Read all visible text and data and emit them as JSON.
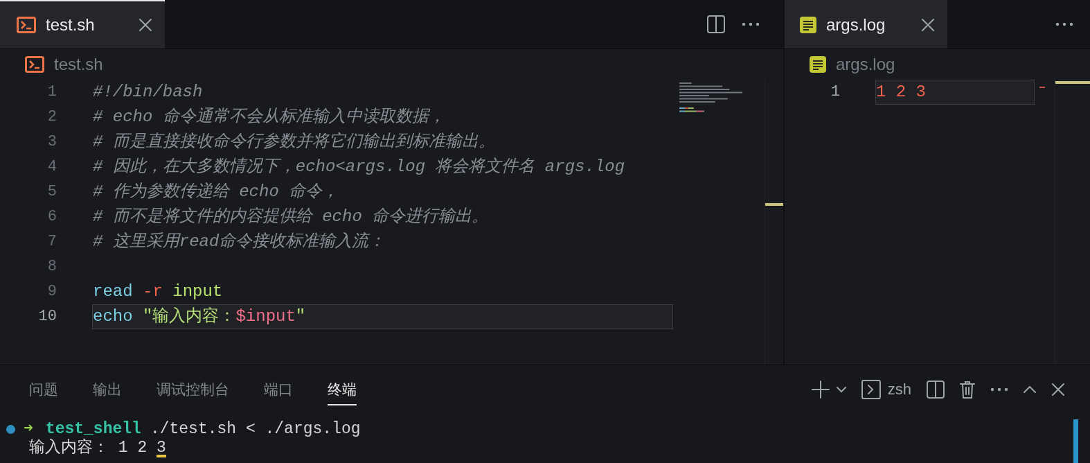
{
  "editor_groups": [
    {
      "tabs": [
        {
          "label": "test.sh",
          "kind": "shell",
          "selected": true
        }
      ],
      "actions": [
        {
          "kind": "split"
        },
        {
          "kind": "more"
        }
      ],
      "breadcrumb": {
        "label": "test.sh",
        "kind": "shell"
      },
      "lines": [
        {
          "number": "1",
          "current": false,
          "tokens": [
            {
              "kind": "comment",
              "text": "#!/bin/bash"
            }
          ]
        },
        {
          "number": "2",
          "current": false,
          "tokens": [
            {
              "kind": "comment",
              "text": "# echo 命令通常不会从标准输入中读取数据，"
            }
          ]
        },
        {
          "number": "3",
          "current": false,
          "tokens": [
            {
              "kind": "comment",
              "text": "# 而是直接接收命令行参数并将它们输出到标准输出。"
            }
          ]
        },
        {
          "number": "4",
          "current": false,
          "tokens": [
            {
              "kind": "comment",
              "text": "# 因此，在大多数情况下，echo<args.log 将会将文件名 args.log"
            }
          ]
        },
        {
          "number": "5",
          "current": false,
          "tokens": [
            {
              "kind": "comment",
              "text": "# 作为参数传递给 echo 命令，"
            }
          ]
        },
        {
          "number": "6",
          "current": false,
          "tokens": [
            {
              "kind": "comment",
              "text": "# 而不是将文件的内容提供给 echo 命令进行输出。"
            }
          ]
        },
        {
          "number": "7",
          "current": false,
          "tokens": [
            {
              "kind": "comment",
              "text": "# 这里采用read命令接收标准输入流："
            }
          ]
        },
        {
          "number": "8",
          "current": false
        },
        {
          "number": "9",
          "current": false,
          "tokens": [
            {
              "kind": "keyword",
              "text": "read "
            },
            {
              "kind": "flag",
              "text": "-r "
            },
            {
              "kind": "name",
              "text": "input"
            }
          ]
        },
        {
          "number": "10",
          "current": true,
          "tokens": [
            {
              "kind": "keyword",
              "text": "echo "
            },
            {
              "kind": "string",
              "text": "\"输入内容："
            },
            {
              "kind": "variable",
              "text": "$input"
            },
            {
              "kind": "string",
              "text": "\""
            }
          ]
        }
      ]
    },
    {
      "tabs": [
        {
          "label": "args.log",
          "kind": "log",
          "selected": true
        }
      ],
      "actions": [
        {
          "kind": "more"
        }
      ],
      "breadcrumb": {
        "label": "args.log",
        "kind": "log"
      },
      "lines": [
        {
          "number": "1",
          "current": true,
          "tokens": [
            {
              "kind": "number",
              "text": "1 2 3"
            }
          ]
        }
      ]
    }
  ],
  "panel": {
    "tabs": [
      {
        "label": "问题",
        "selected": false
      },
      {
        "label": "输出",
        "selected": false
      },
      {
        "label": "调试控制台",
        "selected": false
      },
      {
        "label": "端口",
        "selected": false
      },
      {
        "label": "终端",
        "selected": true
      }
    ],
    "actions": [
      {
        "kind": "plus"
      },
      {
        "kind": "dropdown"
      },
      {
        "kind": "terminal",
        "label": "zsh"
      },
      {
        "kind": "split"
      },
      {
        "kind": "trash"
      },
      {
        "kind": "more"
      },
      {
        "kind": "maximize"
      },
      {
        "kind": "close"
      }
    ],
    "terminal": [
      {
        "kind": "prompt",
        "color": "#2f8fc1",
        "arrow": "➜",
        "directory": "test_shell",
        "command": "./test.sh < ./args.log"
      },
      {
        "kind": "output",
        "text": "输入内容： 1 2 3",
        "cursor": true
      }
    ]
  }
}
